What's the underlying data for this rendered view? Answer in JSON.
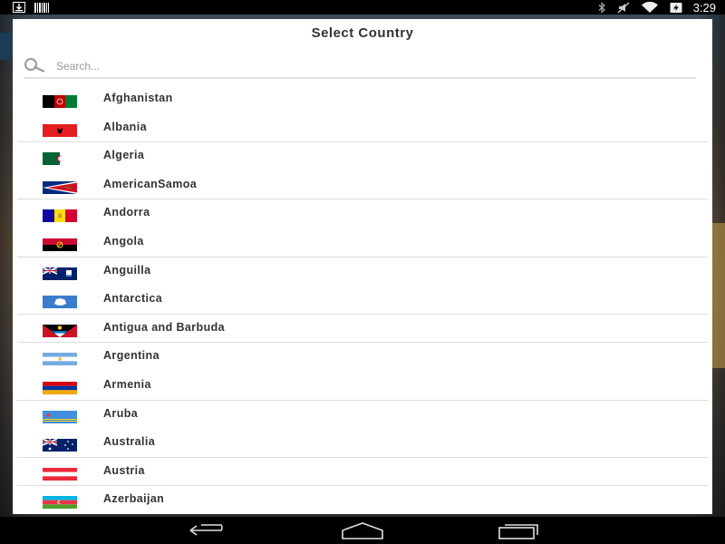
{
  "status_bar": {
    "time": "3:29",
    "icons": [
      "download-icon",
      "barcode-icon",
      "bluetooth-icon",
      "mute-icon",
      "wifi-icon",
      "battery-charging-icon"
    ]
  },
  "dialog": {
    "title": "Select Country",
    "search": {
      "placeholder": "Search...",
      "value": ""
    }
  },
  "countries": [
    "Afghanistan",
    "Albania",
    "Algeria",
    "AmericanSamoa",
    "Andorra",
    "Angola",
    "Anguilla",
    "Antarctica",
    "Antigua and Barbuda",
    "Argentina",
    "Armenia",
    "Aruba",
    "Australia",
    "Austria",
    "Azerbaijan"
  ],
  "nav_bar": {
    "buttons": [
      "back-icon",
      "home-icon",
      "recent-apps-icon"
    ]
  }
}
